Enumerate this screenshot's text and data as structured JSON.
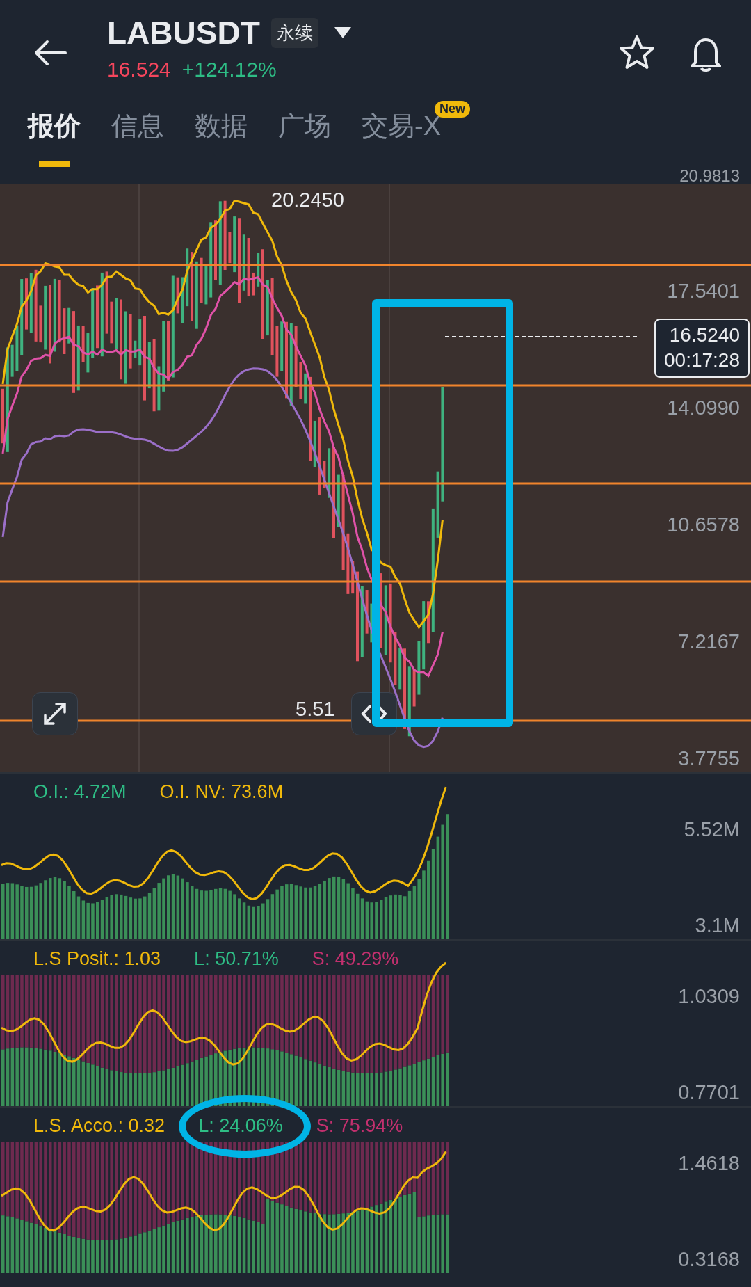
{
  "header": {
    "title": "LABUSDT",
    "badge": "永续",
    "price": "16.524",
    "change": "+124.12%"
  },
  "tabs": [
    {
      "label": "报价",
      "selected": true
    },
    {
      "label": "信息",
      "selected": false
    },
    {
      "label": "数据",
      "selected": false
    },
    {
      "label": "广场",
      "selected": false
    },
    {
      "label": "交易-X",
      "selected": false,
      "badge": "New"
    }
  ],
  "main_chart": {
    "axis_labels": [
      "20.9813",
      "17.5401",
      "14.0990",
      "10.6578",
      "7.2167",
      "3.7755"
    ],
    "high_label": "20.2450",
    "low_label": "5.51",
    "price_tag": {
      "price": "16.5240",
      "countdown": "00:17:28"
    }
  },
  "panels": [
    {
      "kind": "oi",
      "axis_labels": [
        "5.52M",
        "3.1M"
      ],
      "legend": [
        {
          "text": "O.I.: 4.72M",
          "color": "#2ebd85"
        },
        {
          "text": "O.I. NV: 73.6M",
          "color": "#f0b90b"
        }
      ]
    },
    {
      "kind": "ratio",
      "axis_labels": [
        "1.0309",
        "0.7701"
      ],
      "legend": [
        {
          "text": "L.S Posit.: 1.03",
          "color": "#f0b90b"
        },
        {
          "text": "L: 50.71%",
          "color": "#2ebd85"
        },
        {
          "text": "S: 49.29%",
          "color": "#c2306e"
        }
      ]
    },
    {
      "kind": "ratio",
      "axis_labels": [
        "1.4618",
        "0.3168"
      ],
      "legend": [
        {
          "text": "L.S. Acco.: 0.32",
          "color": "#f0b90b"
        },
        {
          "text": "L: 24.06%",
          "color": "#2ebd85",
          "circled": true
        },
        {
          "text": "S: 75.94%",
          "color": "#c2306e"
        }
      ]
    }
  ]
}
